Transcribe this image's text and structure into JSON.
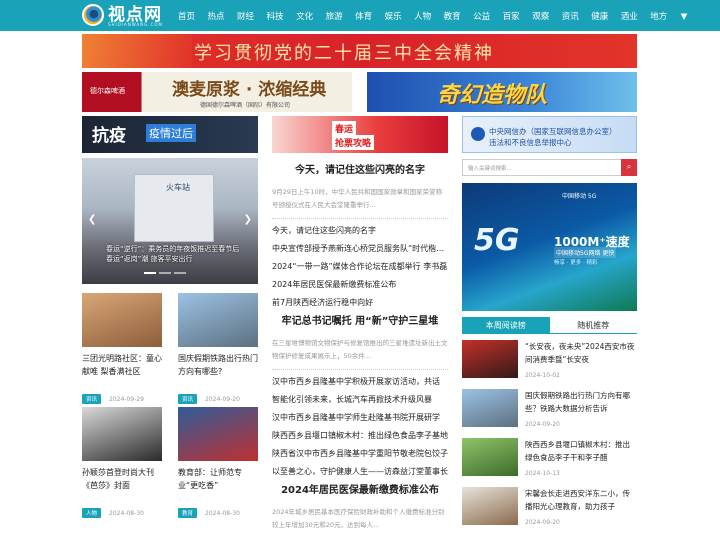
{
  "site": {
    "name": "视点网",
    "sub": "SHIDIANWANG.COM"
  },
  "nav": [
    "首页",
    "热点",
    "财经",
    "科技",
    "文化",
    "旅游",
    "体育",
    "娱乐",
    "人物",
    "教育",
    "公益",
    "百家",
    "观察",
    "资讯",
    "健康",
    "酒业",
    "地方"
  ],
  "banners": {
    "top_slogan": "学习贯彻党的二十届三中全会精神",
    "beer_brand": "德尔森啤酒",
    "beer_slogan": "澳麦原浆 · 浓缩经典",
    "beer_company": "德国德尔森啤酒（国际）有限公司",
    "magic": "奇幻造物队",
    "fight_a": "抗疫",
    "fight_b": "疫情过后",
    "spring_a": "春运",
    "spring_b": "抢票攻略",
    "report_a": "中央网信办（国家互联网信息办公室）",
    "report_b": "违法和不良信息举报中心"
  },
  "slider": {
    "building_label": "火车站",
    "caption": "春运“逆行”：乘务员的年夜饭推迟至春节后 春运“返岗”潮 旅客平安出行"
  },
  "cards": [
    {
      "title": "三团光明路社区：童心献唯 梨香满社区",
      "tag": "资讯",
      "date": "2024-09-29",
      "color1": "#d8a777",
      "color2": "#8c5e3b"
    },
    {
      "title": "国庆假期铁路出行热门方向有哪些?",
      "tag": "资讯",
      "date": "2024-09-20",
      "color1": "#9cc2e4",
      "color2": "#5c7080"
    },
    {
      "title": "孙颖莎首登时尚大刊《芭莎》封面",
      "tag": "人物",
      "date": "2024-08-30",
      "color1": "#d9d9d9",
      "color2": "#2a2a2a"
    },
    {
      "title": "教育部：让师范专业“更吃香”",
      "tag": "教育",
      "date": "2024-08-30",
      "color1": "#2f5c9a",
      "color2": "#c03030"
    }
  ],
  "headline1": {
    "title": "今天，请记住这些闪亮的名字",
    "summary": "9月29日上午10时，中华人民共和国国家勋章和国家荣誉称号颁授仪式在人民大会堂隆重举行..."
  },
  "list1": [
    "今天，请记住这些闪亮的名字",
    "中央宣传部授予燕新连心桥党员服务队“时代楷模”",
    "2024“一带一路”媒体合作论坛在成都举行 李书磊",
    "2024年居民医保最新缴费标准公布",
    "前7月陕西经济运行稳中向好"
  ],
  "headline2": {
    "title": "牢记总书记嘱托 用“新”守护三星堆",
    "summary": "在三星堆博物馆文物保护与修复馆推出的三星堆遗址新出土文物保护修复成果展示上，50余件..."
  },
  "list2": [
    "汉中市西乡县隆基中学积极开展家访活动，共话",
    "智能化引领未来，长城汽车再掀技术升级风暴",
    "汉中市西乡县隆基中学师生赴隆基书院开展研学",
    "陕西西乡县堰口镇椒木村：推出绿色食品李子基地",
    "陕西省汉中市西乡县隆基中学重阳节敬老院包饺子",
    "以至善之心，守护健康人生——访森益汀堂董事长"
  ],
  "headline3": {
    "title": "2024年居民医保最新缴费标准公布",
    "summary": "2024年城乡居民基本医疗保险财政补助和个人缴费标准分别较上年增加30元和20元，达到每人..."
  },
  "search": {
    "placeholder": "输入关键词搜索...",
    "button": "⌕"
  },
  "ad5g": {
    "logo": "中国移动 5G",
    "big": "5G",
    "speed": "1000M⁺速度",
    "line": "中国移动5G网络 更快",
    "tail": "畅享 · 更多 · 精彩"
  },
  "tabs": [
    "本周阅读榜",
    "随机推荐"
  ],
  "side": [
    {
      "title": "“长安夜，夜未央”2024西安市夜间消费季暨“长安夜",
      "date": "2024-10-02",
      "color1": "#c4302b",
      "color2": "#331a18"
    },
    {
      "title": "国庆假期铁路出行热门方向有哪些？铁路大数据分析告诉",
      "date": "2024-09-20",
      "color1": "#9cc2e4",
      "color2": "#5c7080"
    },
    {
      "title": "陕西西乡县堰口镇椒木村：推出绿色食品李子干和李子醋",
      "date": "2024-10-13",
      "color1": "#8fc46a",
      "color2": "#3e6b2a"
    },
    {
      "title": "宋馨会长走进西安洋东二小，传播阳光心理教育，助力孩子",
      "date": "2024-09-20",
      "color1": "#e8e3da",
      "color2": "#8a6a4c"
    }
  ]
}
